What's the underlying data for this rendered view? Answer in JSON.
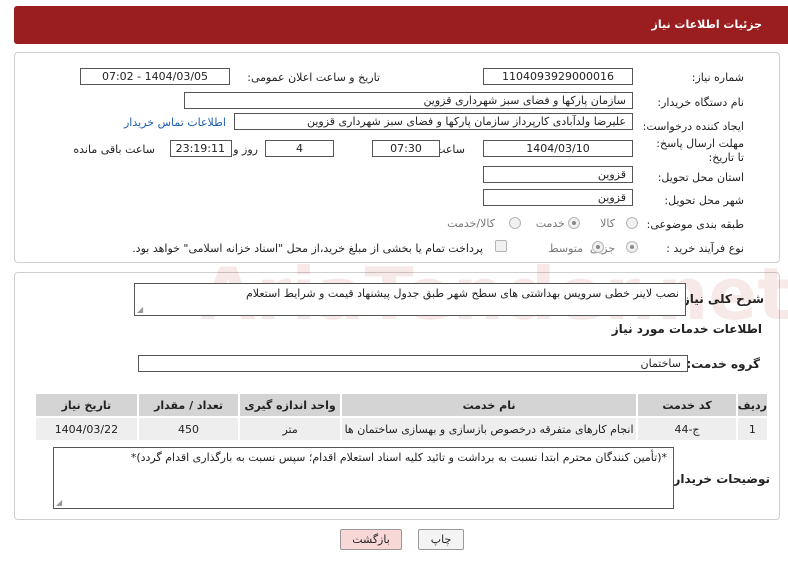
{
  "header": {
    "title": "جزئیات اطلاعات نیاز"
  },
  "need": {
    "number_label": "شماره نیاز:",
    "number": "1104093929000016",
    "announce_label": "تاریخ و ساعت اعلان عمومی:",
    "announce": "1404/03/05 - 07:02",
    "buyer_org_label": "نام دستگاه خریدار:",
    "buyer_org": "سازمان پارکها و فضای سبز شهرداری قزوین",
    "creator_label": "ایجاد کننده درخواست:",
    "creator": "علیرضا ولدآبادی کارپرداز سازمان پارکها و فضای سبز شهرداری قزوین",
    "contact_link": "اطلاعات تماس خریدار",
    "deadline_label": "مهلت ارسال پاسخ: تا تاریخ:",
    "deadline_date": "1404/03/10",
    "time_label": "ساعت",
    "deadline_time": "07:30",
    "days_value": "4",
    "days_label": "روز و",
    "remaining_time": "23:19:11",
    "remaining_label": "ساعت باقی مانده",
    "province_label": "استان محل تحویل:",
    "province": "قزوین",
    "city_label": "شهر محل تحویل:",
    "city": "قزوین",
    "category_label": "طبقه بندی موضوعی:",
    "category_options": [
      "کالا",
      "خدمت",
      "کالا/خدمت"
    ],
    "process_label": "نوع فرآیند خرید :",
    "process_options": [
      "جزیی",
      "متوسط"
    ],
    "payment_note": "پرداخت تمام یا بخشی از مبلغ خرید،از محل \"اسناد خزانه اسلامی\" خواهد بود."
  },
  "details": {
    "summary_label": "شرح کلی نیاز:",
    "summary": "نصب لاینر خطی سرویس بهداشتی های سطح شهر طبق جدول پیشنهاد قیمت و شرایط استعلام",
    "services_heading": "اطلاعات خدمات مورد نیاز",
    "group_label": "گروه خدمت:",
    "group": "ساختمان",
    "table": {
      "headers": [
        "ردیف",
        "کد خدمت",
        "نام خدمت",
        "واحد اندازه گیری",
        "تعداد / مقدار",
        "تاریخ نیاز"
      ],
      "rows": [
        [
          "1",
          "ج-44",
          "انجام کارهای متفرقه درخصوص بازسازی و بهسازی ساختمان ها",
          "متر",
          "450",
          "1404/03/22"
        ]
      ]
    },
    "buyer_notes_label": "توضیحات خریدار:",
    "buyer_notes": "*(تأمین کنندگان محترم ابتدا نسبت به برداشت و تائید کلیه اسناد استعلام اقدام؛ سپس نسبت به بارگذاری اقدام گردد)*"
  },
  "buttons": {
    "print": "چاپ",
    "back": "بازگشت"
  },
  "watermark": "AriaTender.net",
  "colors": {
    "header": "#9a1d1f",
    "link": "#1a5fb4",
    "back_button": "#f8d7d7"
  }
}
